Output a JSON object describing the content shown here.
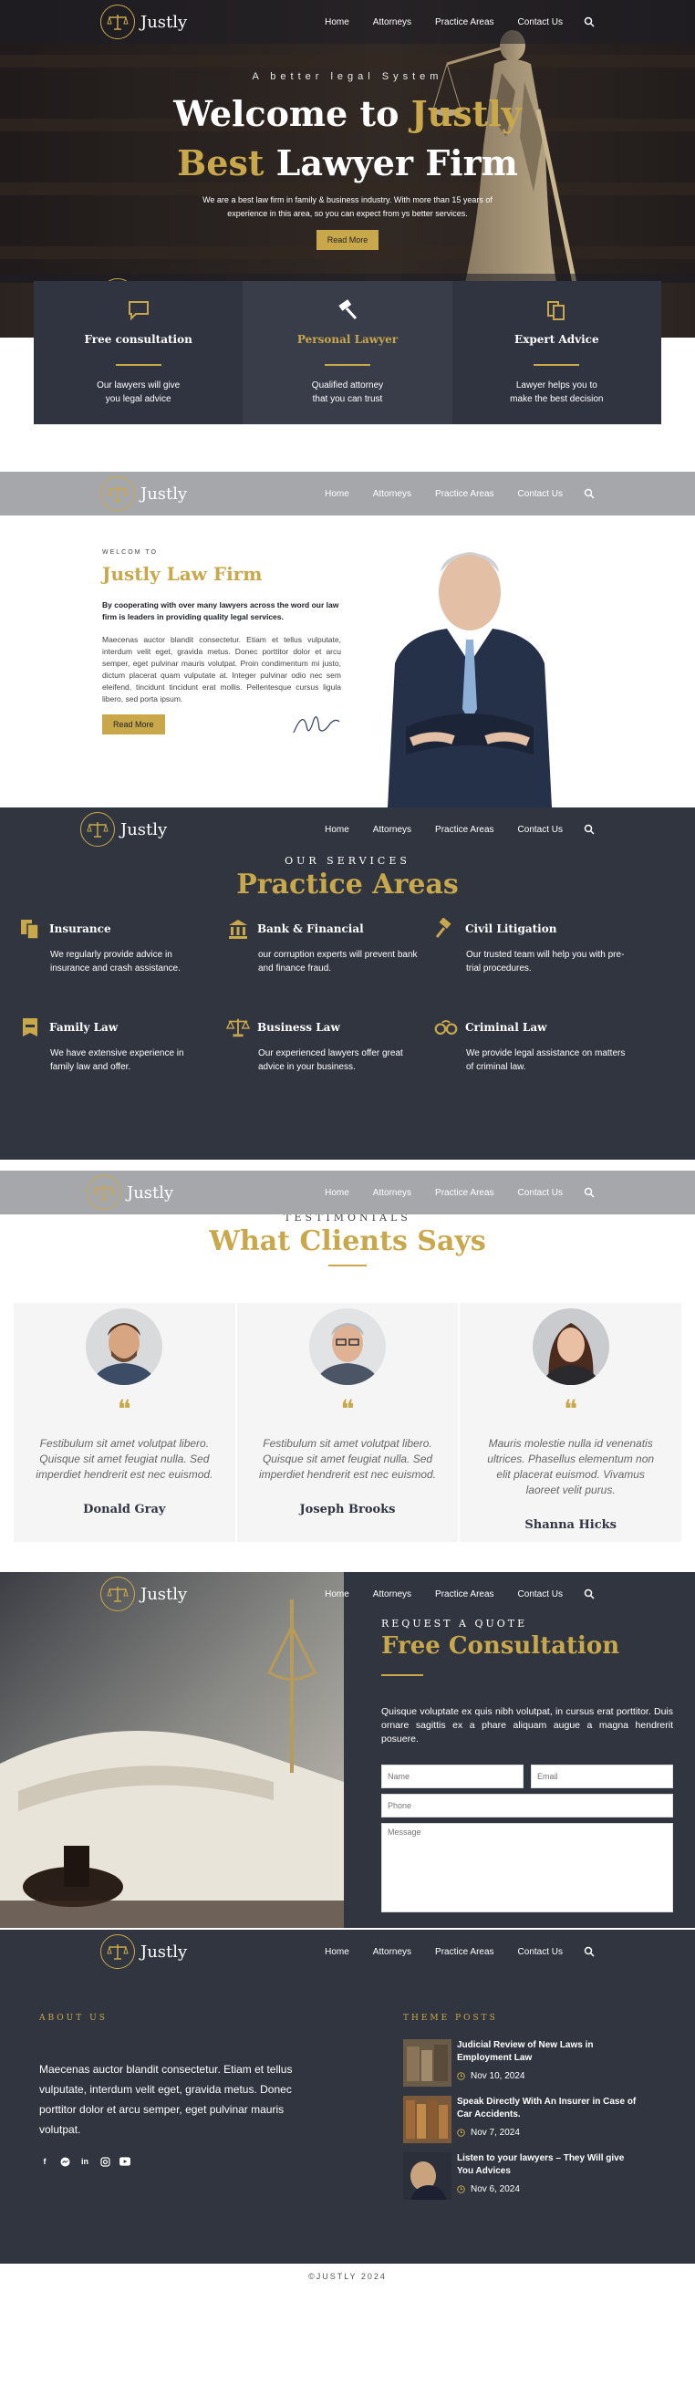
{
  "brand": {
    "name": "Justly",
    "accent": "#c9a84c",
    "dark": "#30353f"
  },
  "nav": {
    "home": "Home",
    "attorneys": "Attorneys",
    "practice": "Practice Areas",
    "contact": "Contact Us"
  },
  "hero": {
    "eyebrow": "A better legal System",
    "title_line1_a": "Welcome to ",
    "title_line1_b": "Justly",
    "title_line2_a": "Best",
    "title_line2_b": " Lawyer Firm",
    "subtitle_1": "We are a best law firm in family & business industry. With more than 15 years of",
    "subtitle_2": "experience in this area, so you can expect from ys better services.",
    "cta": "Read More"
  },
  "features": [
    {
      "title": "Free consultation",
      "text_1": "Our lawyers will give",
      "text_2": "you legal advice",
      "icon": "chat-icon"
    },
    {
      "title": "Personal Lawyer",
      "text_1": "Qualified attorney",
      "text_2": "that you can trust",
      "icon": "gavel-icon"
    },
    {
      "title": "Expert Advice",
      "text_1": "Lawyer helps you to",
      "text_2": "make the best decision",
      "icon": "documents-icon"
    }
  ],
  "about": {
    "eyebrow": "WELCOM TO",
    "title": "Justly Law Firm",
    "lead": "By cooperating with over many lawyers across the word our law firm is leaders in providing quality legal services.",
    "body": "Maecenas auctor blandit consectetur. Etiam et tellus vulputate, interdum velit eget, gravida metus. Donec porttitor dolor et arcu semper, eget pulvinar mauris volutpat. Proin condimentum mi justo, dictum placerat quam vulputate at. Integer pulvinar odio nec sem eleifend, tincidunt tincidunt erat mollis. Pellentesque cursus ligula libero, sed porta ipsum.",
    "cta": "Read More"
  },
  "practice": {
    "eyebrow": "OUR SERVICES",
    "title": "Practice Areas",
    "items": [
      {
        "title": "Insurance",
        "text": "We regularly provide advice in insurance and crash assistance.",
        "icon": "documents-icon"
      },
      {
        "title": "Bank & Financial",
        "text": "our corruption experts will prevent bank and finance fraud.",
        "icon": "bank-icon"
      },
      {
        "title": "Civil Litigation",
        "text": "Our trusted team will help you with pre-trial procedures.",
        "icon": "gavel-icon"
      },
      {
        "title": "Family Law",
        "text": "We have extensive experience in family law and offer.",
        "icon": "briefcase-icon"
      },
      {
        "title": "Business Law",
        "text": "Our experienced lawyers offer great advice in your business.",
        "icon": "scales-icon"
      },
      {
        "title": "Criminal Law",
        "text": "We provide legal assistance on matters of criminal law.",
        "icon": "handcuffs-icon"
      }
    ]
  },
  "testimonials": {
    "eyebrow": "TESTIMONIALS",
    "title": "What Clients Says",
    "items": [
      {
        "text": "Festibulum sit amet volutpat libero. Quisque sit amet feugiat nulla. Sed imperdiet hendrerit est nec euismod.",
        "name": "Donald Gray"
      },
      {
        "text": "Festibulum sit amet volutpat libero. Quisque sit amet feugiat nulla. Sed imperdiet hendrerit est nec euismod.",
        "name": "Joseph Brooks"
      },
      {
        "text": "Mauris molestie nulla id venenatis ultrices. Phasellus elementum non elit placerat euismod. Vivamus laoreet velit purus.",
        "name": "Shanna Hicks"
      }
    ]
  },
  "consult": {
    "eyebrow": "REQUEST A QUOTE",
    "title": "Free Consultation",
    "text": "Quisque voluptate ex quis nibh volutpat, in cursus erat porttitor. Duis ornare sagittis ex a phare aliquam augue a magna hendrerit posuere.",
    "name_ph": "Name",
    "email_ph": "Email",
    "phone_ph": "Phone",
    "msg_ph": "Message"
  },
  "footer": {
    "about_heading": "ABOUT US",
    "about_text": "Maecenas auctor blandit consectetur. Etiam et tellus vulputate, interdum velit eget, gravida metus. Donec porttitor dolor et arcu semper, eget pulvinar mauris volutpat.",
    "posts_heading": "THEME POSTS",
    "posts": [
      {
        "title": "Judicial Review of New Laws in Employment Law",
        "date": "Nov 10, 2024"
      },
      {
        "title": "Speak Directly With An Insurer in Case of Car Accidents.",
        "date": "Nov 7, 2024"
      },
      {
        "title": "Listen to your lawyers – They Will give You Advices",
        "date": "Nov 6, 2024"
      }
    ],
    "copyright": "©JUSTLY 2024"
  }
}
